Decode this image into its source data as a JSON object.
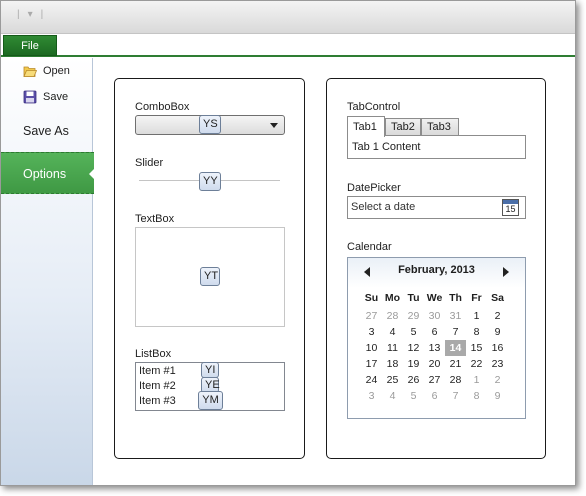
{
  "window": {
    "quick_access": [
      "|",
      "▾",
      "|"
    ]
  },
  "ribbon": {
    "file_tab": "File"
  },
  "backstage": {
    "open_label": "Open",
    "save_label": "Save",
    "save_as_label": "Save As",
    "options_label": "Options"
  },
  "left_panel": {
    "combobox_label": "ComboBox",
    "combobox_tag": "YS",
    "slider_label": "Slider",
    "slider_tag": "YY",
    "textbox_label": "TextBox",
    "textbox_tag": "YT",
    "listbox_label": "ListBox",
    "listbox_items": [
      "Item #1",
      "Item #2",
      "Item #3"
    ],
    "listbox_tags": [
      "YI",
      "YE",
      "YM"
    ]
  },
  "right_panel": {
    "tabcontrol_label": "TabControl",
    "tabs": [
      "Tab1",
      "Tab2",
      "Tab3"
    ],
    "tab_content": "Tab 1 Content",
    "datepicker_label": "DatePicker",
    "datepicker_placeholder": "Select a date",
    "datepicker_icon_day": "15",
    "calendar_label": "Calendar",
    "calendar": {
      "title": "February, 2013",
      "days_of_week": [
        "Su",
        "Mo",
        "Tu",
        "We",
        "Th",
        "Fr",
        "Sa"
      ],
      "weeks": [
        [
          "27",
          "28",
          "29",
          "30",
          "31",
          "1",
          "2"
        ],
        [
          "3",
          "4",
          "5",
          "6",
          "7",
          "8",
          "9"
        ],
        [
          "10",
          "11",
          "12",
          "13",
          "14",
          "15",
          "16"
        ],
        [
          "17",
          "18",
          "19",
          "20",
          "21",
          "22",
          "23"
        ],
        [
          "24",
          "25",
          "26",
          "27",
          "28",
          "1",
          "2"
        ],
        [
          "3",
          "4",
          "5",
          "6",
          "7",
          "8",
          "9"
        ]
      ],
      "today": "14"
    }
  },
  "colors": {
    "accent_green": "#3f9944",
    "file_tab_green": "#1d6a22"
  }
}
